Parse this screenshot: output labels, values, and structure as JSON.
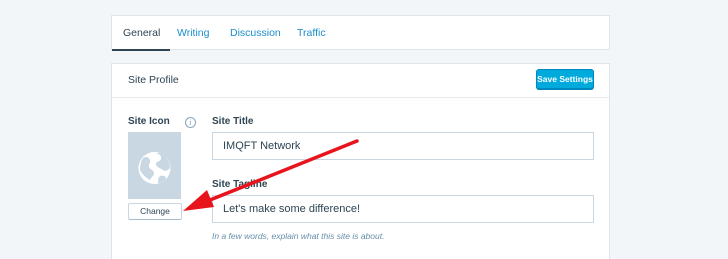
{
  "tabs": [
    {
      "label": "General",
      "selected": true
    },
    {
      "label": "Writing",
      "selected": false
    },
    {
      "label": "Discussion",
      "selected": false
    },
    {
      "label": "Traffic",
      "selected": false
    }
  ],
  "site_profile": {
    "title": "Site Profile",
    "save_button": "Save Settings",
    "site_icon_label": "Site Icon",
    "info_icon_glyph": "i",
    "change_button": "Change",
    "site_title_label": "Site Title",
    "site_title_value": "IMQFT Network",
    "site_tagline_label": "Site Tagline",
    "site_tagline_value": "Let's make some difference!",
    "tagline_hint": "In a few words, explain what this site is about."
  },
  "colors": {
    "accent": "#00aadc",
    "link": "#1c8ec9",
    "text": "#2e4453",
    "annotation_arrow": "#e8141c",
    "icon_placeholder": "#c8d7e1"
  },
  "icons": {
    "site_icon_placeholder": "globe-icon",
    "info": "info-icon"
  }
}
